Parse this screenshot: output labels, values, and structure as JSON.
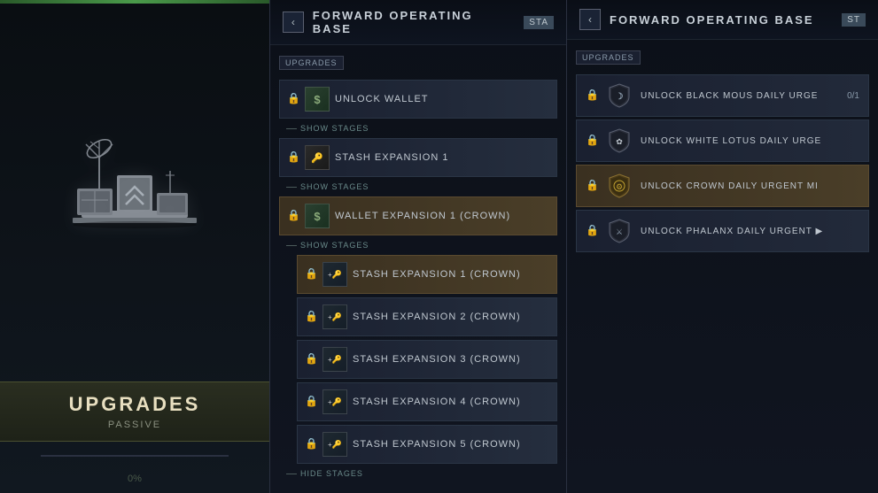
{
  "leftPanel": {
    "topBarColor": "#4a9a4a",
    "title": "UPGRADES",
    "subtitle": "PASSIVE",
    "progressText": "0%"
  },
  "middlePanel": {
    "backButton": "‹",
    "title": "FORWARD OPERATING BASE",
    "badge": "STA",
    "sectionLabel": "UPGRADES",
    "items": [
      {
        "id": "unlock-wallet",
        "label": "UNLOCK WALLET",
        "iconType": "dollar",
        "locked": true,
        "highlighted": false
      }
    ],
    "showStages1": "SHOW STAGES",
    "showStages2": "SHOW STAGES",
    "showStages3": "SHOW STAGES",
    "hideStages": "HIDE STAGES",
    "stashExpansion1": "STASH EXPANSION 1",
    "walletExpansion": "WALLET EXPANSION 1 (CROWN)",
    "stashCrown1": "STASH EXPANSION 1 (CROWN)",
    "stashCrown2": "STASH EXPANSION 2 (CROWN)",
    "stashCrown3": "STASH EXPANSION 3 (CROWN)",
    "stashCrown4": "STASH EXPANSION 4 (CROWN)",
    "stashCrown5": "STASH EXPANSION 5 (CROWN)"
  },
  "rightPanel": {
    "backButton": "‹",
    "title": "FORWARD OPERATING BASE",
    "badge": "ST",
    "sectionLabel": "UPGRADES",
    "items": [
      {
        "id": "black-mous",
        "label": "UNLOCK BLACK MOUS DAILY URGE",
        "badgeCount": "0/1",
        "locked": true,
        "highlighted": false
      },
      {
        "id": "white-lotus",
        "label": "UNLOCK WHITE LOTUS DAILY URGE",
        "badgeCount": "",
        "locked": true,
        "highlighted": false
      },
      {
        "id": "crown",
        "label": "UNLOCK CROWN DAILY URGENT MI",
        "badgeCount": "",
        "locked": true,
        "highlighted": true
      },
      {
        "id": "phalanx",
        "label": "UNLOCK PHALANX DAILY URGENT ▶",
        "badgeCount": "",
        "locked": true,
        "highlighted": false
      }
    ]
  }
}
